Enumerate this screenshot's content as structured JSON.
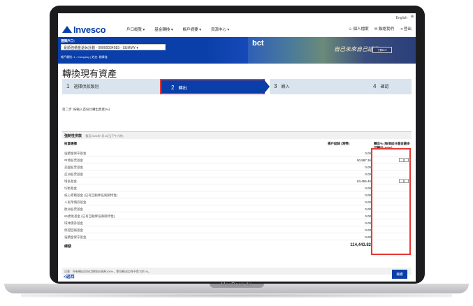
{
  "device": {
    "model": "MacBook Air"
  },
  "utility": {
    "language": "English",
    "menu_icon": "hamburger-icon"
  },
  "nav": {
    "brand": "Invesco",
    "items": [
      "戶口概覽 ▾",
      "基金轉換 ▾",
      "帳戶摘要 ▾",
      "資源中心 ▾"
    ],
    "right": [
      "個人檔案",
      "聯絡我們",
      "登出"
    ]
  },
  "banner": {
    "account_title": "選擇戶口：",
    "account_value": "景順強積金退休計劃 - 00000034583 - SUMMY",
    "account_meta": "帳戶類別: 1 - Company | 姓名: 劉偉強",
    "promo_brand": "bct",
    "promo_script": "自己未來自己話事",
    "promo_button": "了解BCT"
  },
  "page": {
    "title": "轉換現有資產",
    "substep": "第二步: 按輸入百份比轉出資產(%)"
  },
  "steps": [
    {
      "num": "1",
      "label": "選擇供款類別"
    },
    {
      "num": "2",
      "label": "轉出"
    },
    {
      "num": "3",
      "label": "轉入"
    },
    {
      "num": "4",
      "label": "確認"
    }
  ],
  "table": {
    "section_title": "強制性供款",
    "section_note": "截至2024年7月15日(下午六時)",
    "col_fund": "投資選擇",
    "col_balance": "帳戶結餘 (港幣)",
    "col_pct": "轉出% (每項成分基金最多可轉出100%)",
    "rows": [
      {
        "name": "強積金保守基金",
        "balance": "0.00",
        "input": ""
      },
      {
        "name": "中港股票基金",
        "balance": "50,987.36",
        "input": "0"
      },
      {
        "name": "美國股票基金",
        "balance": "0.00",
        "input": ""
      },
      {
        "name": "亞洲股票基金",
        "balance": "0.00",
        "input": ""
      },
      {
        "name": "增長基金",
        "balance": "63,456.46",
        "input": "0"
      },
      {
        "name": "均衡基金",
        "balance": "0.00",
        "input": ""
      },
      {
        "name": "核心累積基金 (已有自動降低風險特性)",
        "balance": "0.00",
        "input": ""
      },
      {
        "name": "人民幣債券基金",
        "balance": "0.00",
        "input": ""
      },
      {
        "name": "歐洲股票基金",
        "balance": "0.00",
        "input": ""
      },
      {
        "name": "65歲後基金 (已有自動降低風險特性)",
        "balance": "0.00",
        "input": ""
      },
      {
        "name": "環球債券基金",
        "balance": "0.00",
        "input": ""
      },
      {
        "name": "保證回報基金",
        "balance": "0.00",
        "input": ""
      },
      {
        "name": "強積金保守基金",
        "balance": "0.00",
        "input": ""
      }
    ],
    "total_label": "總額",
    "total_value": "114,443.82"
  },
  "footnote": "注意：所有轉出百份比總和必須為100%，單位轉出比例不得少於1%。",
  "actions": {
    "back": "<返回",
    "next": "繼續"
  },
  "colors": {
    "brand": "#0a3ea8",
    "highlight": "#e53935",
    "step_bg": "#d9e4ee"
  }
}
